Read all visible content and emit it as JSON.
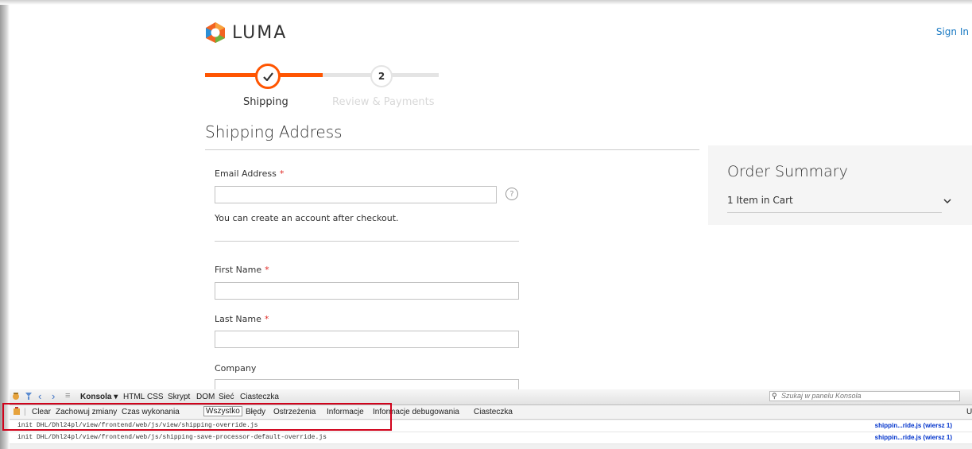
{
  "store": {
    "logo_text": "LUMA",
    "sign_in": "Sign In"
  },
  "progress": {
    "step1_label": "Shipping",
    "step2_number": "2",
    "step2_label": "Review & Payments"
  },
  "shipping": {
    "title": "Shipping Address",
    "email_label": "Email Address",
    "required_mark": "*",
    "email_value": "",
    "help_symbol": "?",
    "account_note": "You can create an account after checkout.",
    "first_name_label": "First Name",
    "first_name_value": "",
    "last_name_label": "Last Name",
    "last_name_value": "",
    "company_label": "Company",
    "company_value": ""
  },
  "summary": {
    "title": "Order Summary",
    "items_in_cart": "1 Item in Cart"
  },
  "devtools": {
    "toolbar": [
      "Konsola ▾",
      "HTML",
      "CSS",
      "Skrypt",
      "DOM",
      "Sieć",
      "Ciasteczka"
    ],
    "search_placeholder": "Szukaj w panelu Konsola",
    "filter_actions": [
      "Clear",
      "Zachowuj zmiany",
      "Czas wykonania"
    ],
    "filters": [
      "Wszystko",
      "Błędy",
      "Ostrzeżenia",
      "Informacje",
      "Informacje debugowania",
      "Ciasteczka"
    ],
    "active_filter": "Wszystko",
    "right_label": "U",
    "logs": [
      {
        "text": "init DHL/Dhl24pl/view/frontend/web/js/view/shipping-override.js",
        "source": "shippin...ride.js (wiersz 1)"
      },
      {
        "text": "init DHL/Dhl24pl/view/frontend/web/js/shipping-save-processor-default-override.js",
        "source": "shippin...ride.js (wiersz 1)"
      }
    ]
  },
  "colors": {
    "accent": "#ff5501",
    "link": "#1979c3",
    "required": "#e02b27",
    "highlight_box": "#d0021b"
  }
}
